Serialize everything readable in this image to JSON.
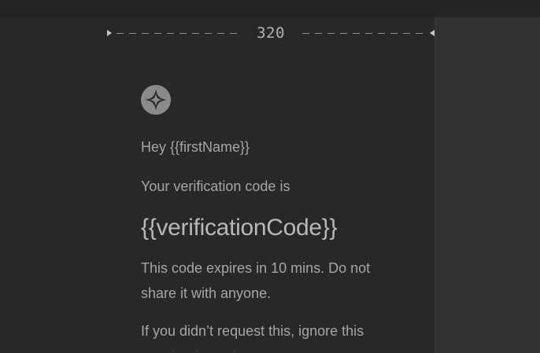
{
  "preview": {
    "width_label": "320"
  },
  "email": {
    "logo_icon": "brand-logo-icon",
    "greeting": "Hey {{firstName}}",
    "intro": "Your verification code is",
    "code": "{{verificationCode}}",
    "expiry_message": "This code expires in 10 mins. Do not share it with anyone.",
    "help_message": "If you didn’t request this, ignore this email or let us know at"
  },
  "colors": {
    "background": "#282828",
    "right_panel": "#323232",
    "text": "#a6a6a6",
    "accent_text": "#b8b8b8"
  }
}
